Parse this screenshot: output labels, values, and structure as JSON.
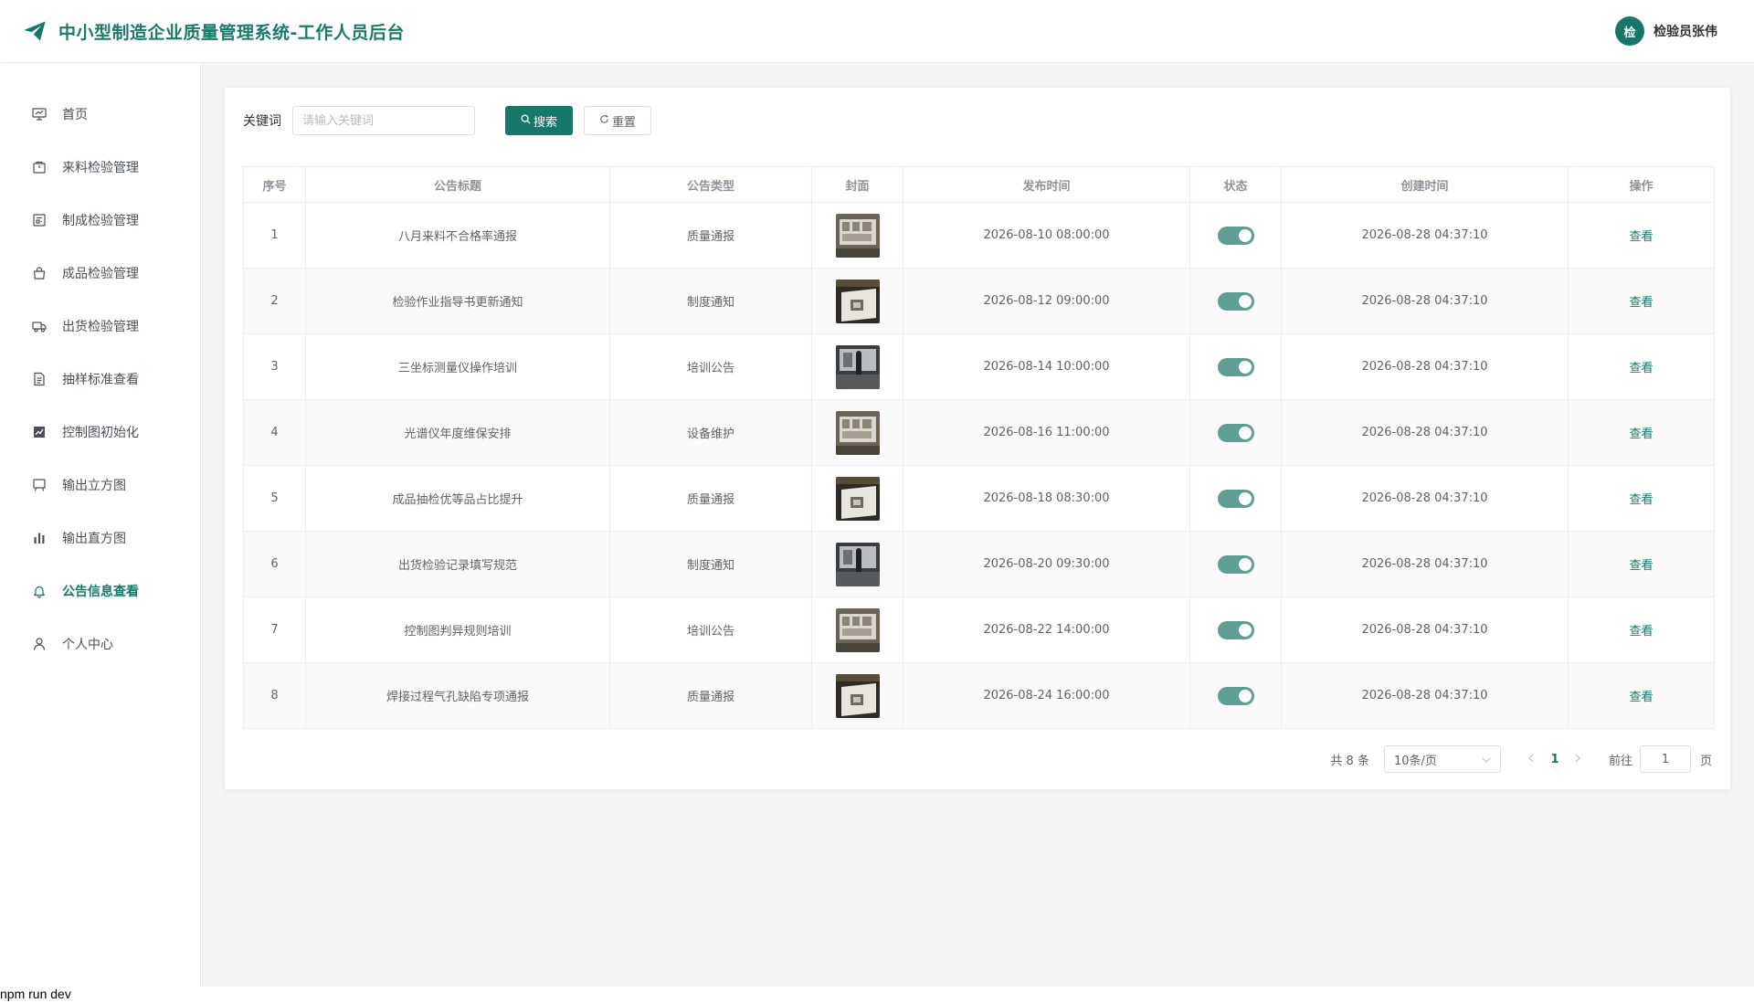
{
  "header": {
    "title": "中小型制造企业质量管理系统-工作人员后台",
    "avatar_text": "检",
    "user_name": "检验员张伟",
    "brand_color": "#17786a"
  },
  "sidebar": {
    "items": [
      {
        "label": "首页",
        "icon": "presentation-icon"
      },
      {
        "label": "来料检验管理",
        "icon": "package-icon"
      },
      {
        "label": "制成检验管理",
        "icon": "document-list-icon"
      },
      {
        "label": "成品检验管理",
        "icon": "shopping-bag-icon"
      },
      {
        "label": "出货检验管理",
        "icon": "truck-icon"
      },
      {
        "label": "抽样标准查看",
        "icon": "file-icon"
      },
      {
        "label": "控制图初始化",
        "icon": "line-chart-icon"
      },
      {
        "label": "输出立方图",
        "icon": "board-icon"
      },
      {
        "label": "输出直方图",
        "icon": "bar-chart-icon"
      },
      {
        "label": "公告信息查看",
        "icon": "bell-icon",
        "active": true
      },
      {
        "label": "个人中心",
        "icon": "user-icon"
      }
    ]
  },
  "search": {
    "label": "关键词",
    "placeholder": "请输入关键词",
    "search_button": "搜索",
    "reset_button": "重置"
  },
  "table": {
    "columns": [
      "序号",
      "公告标题",
      "公告类型",
      "封面",
      "发布时间",
      "状态",
      "创建时间",
      "操作"
    ],
    "rows": [
      {
        "no": "1",
        "title": "八月来料不合格率通报",
        "type": "质量通报",
        "publish": "2026-08-10 08:00:00",
        "status": true,
        "created": "2026-08-28 04:37:10",
        "action": "查看"
      },
      {
        "no": "2",
        "title": "检验作业指导书更新通知",
        "type": "制度通知",
        "publish": "2026-08-12 09:00:00",
        "status": true,
        "created": "2026-08-28 04:37:10",
        "action": "查看"
      },
      {
        "no": "3",
        "title": "三坐标测量仪操作培训",
        "type": "培训公告",
        "publish": "2026-08-14 10:00:00",
        "status": true,
        "created": "2026-08-28 04:37:10",
        "action": "查看"
      },
      {
        "no": "4",
        "title": "光谱仪年度维保安排",
        "type": "设备维护",
        "publish": "2026-08-16 11:00:00",
        "status": true,
        "created": "2026-08-28 04:37:10",
        "action": "查看"
      },
      {
        "no": "5",
        "title": "成品抽检优等品占比提升",
        "type": "质量通报",
        "publish": "2026-08-18 08:30:00",
        "status": true,
        "created": "2026-08-28 04:37:10",
        "action": "查看"
      },
      {
        "no": "6",
        "title": "出货检验记录填写规范",
        "type": "制度通知",
        "publish": "2026-08-20 09:30:00",
        "status": true,
        "created": "2026-08-28 04:37:10",
        "action": "查看"
      },
      {
        "no": "7",
        "title": "控制图判异规则培训",
        "type": "培训公告",
        "publish": "2026-08-22 14:00:00",
        "status": true,
        "created": "2026-08-28 04:37:10",
        "action": "查看"
      },
      {
        "no": "8",
        "title": "焊接过程气孔缺陷专项通报",
        "type": "质量通报",
        "publish": "2026-08-24 16:00:00",
        "status": true,
        "created": "2026-08-28 04:37:10",
        "action": "查看"
      }
    ]
  },
  "pagination": {
    "total_text": "共 8 条",
    "page_size": "10条/页",
    "current_page": "1",
    "goto_label": "前往",
    "goto_value": "1",
    "page_suffix": "页"
  },
  "footer": {
    "text": "npm run dev"
  }
}
